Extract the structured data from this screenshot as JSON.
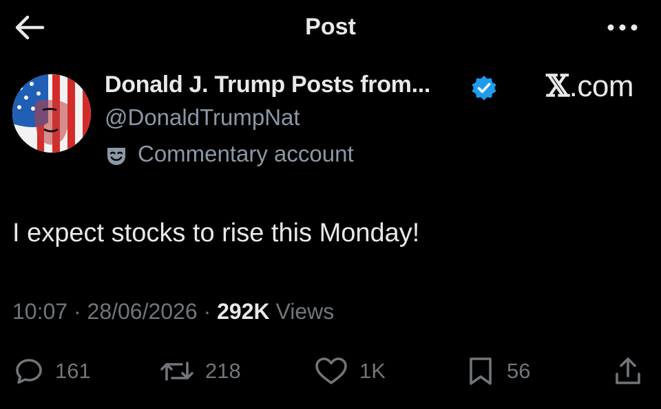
{
  "header": {
    "title": "Post",
    "back_icon": "arrow-left-icon",
    "more_icon": "more-dots-icon"
  },
  "author": {
    "display_name": "Donald J. Trump Posts from...",
    "handle": "@DonaldTrumpNat",
    "label": "Commentary account",
    "verified": true,
    "verified_color": "#1d9bf0"
  },
  "brand": {
    "x_letter": "𝕏",
    "suffix": ".com"
  },
  "post": {
    "text": "I expect stocks to rise this Monday!",
    "time": "10:07",
    "sep1": " · ",
    "date": "28/06/2026",
    "sep2": " · ",
    "views_count": "292K",
    "views_label": " Views"
  },
  "actions": {
    "replies": "161",
    "reposts": "218",
    "likes": "1K",
    "bookmarks": "56"
  },
  "colors": {
    "background": "#000000",
    "text_primary": "#e7e9ea",
    "text_secondary": "#71767b",
    "accent": "#1d9bf0"
  }
}
